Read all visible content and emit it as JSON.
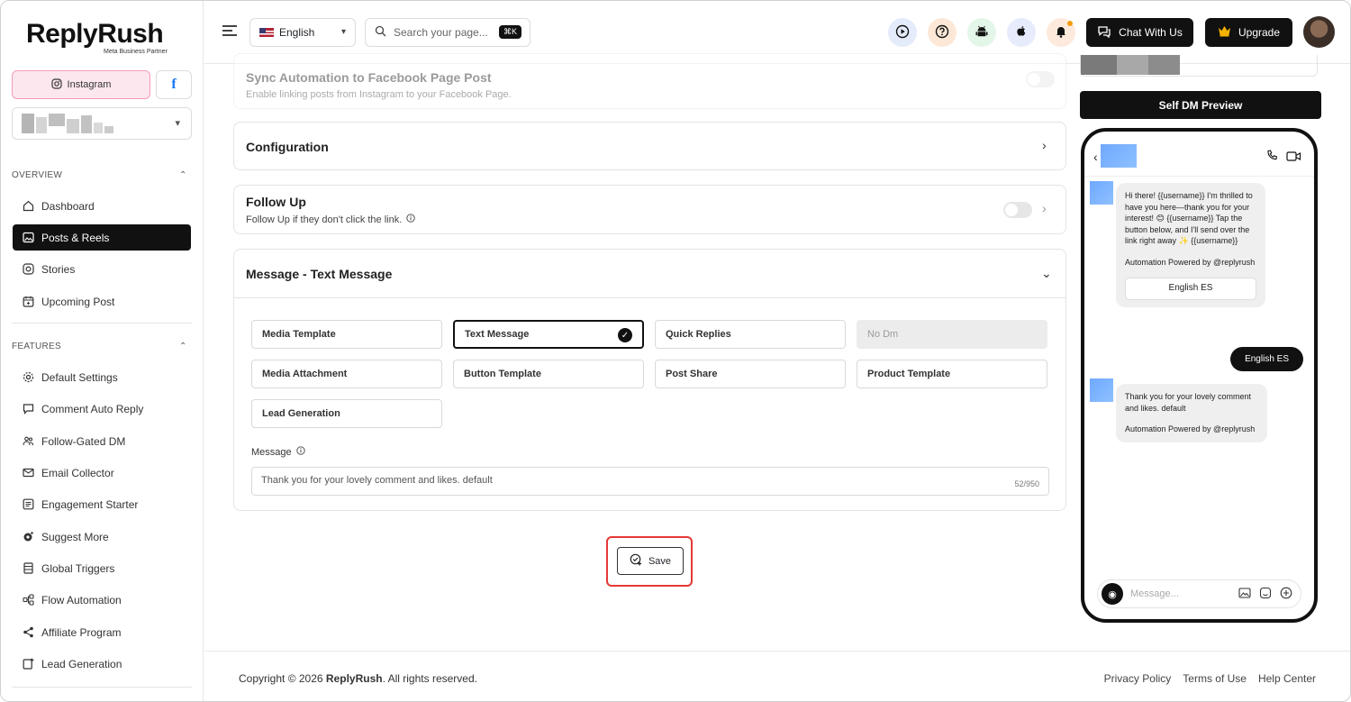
{
  "brand": {
    "name": "ReplyRush",
    "badge": "Meta Business Partner"
  },
  "account": {
    "instagram_label": "Instagram",
    "facebook_glyph": "f"
  },
  "sidebar": {
    "overview_title": "OVERVIEW",
    "features_title": "FEATURES",
    "overview_items": [
      {
        "label": "Dashboard",
        "icon": "home-icon"
      },
      {
        "label": "Posts & Reels",
        "icon": "image-icon",
        "active": true
      },
      {
        "label": "Stories",
        "icon": "instagram-icon"
      },
      {
        "label": "Upcoming Post",
        "icon": "calendar-icon"
      }
    ],
    "feature_items": [
      {
        "label": "Default Settings",
        "icon": "gear-icon"
      },
      {
        "label": "Comment Auto Reply",
        "icon": "comment-icon"
      },
      {
        "label": "Follow-Gated DM",
        "icon": "users-icon"
      },
      {
        "label": "Email Collector",
        "icon": "mail-icon"
      },
      {
        "label": "Engagement Starter",
        "icon": "list-icon"
      },
      {
        "label": "Suggest More",
        "icon": "sparkle-gear-icon"
      },
      {
        "label": "Global Triggers",
        "icon": "stack-icon"
      },
      {
        "label": "Flow Automation",
        "icon": "flow-icon"
      },
      {
        "label": "Affiliate Program",
        "icon": "share-icon"
      },
      {
        "label": "Lead Generation",
        "icon": "lead-icon"
      }
    ]
  },
  "topbar": {
    "language": "English",
    "search_placeholder": "Search your page...",
    "search_shortcut": "⌘K",
    "chat_label": "Chat With Us",
    "upgrade_label": "Upgrade"
  },
  "cards": {
    "sync": {
      "title": "Sync Automation to Facebook Page Post",
      "subtitle": "Enable linking posts from Instagram to your Facebook Page."
    },
    "configuration": {
      "title": "Configuration"
    },
    "follow_up": {
      "title": "Follow Up",
      "subtitle": "Follow Up if they don't click the link."
    },
    "message": {
      "title": "Message - Text Message",
      "options": [
        "Media Template",
        "Text Message",
        "Quick Replies",
        "No Dm",
        "Media Attachment",
        "Button Template",
        "Post Share",
        "Product Template",
        "Lead Generation"
      ],
      "selected": "Text Message",
      "disabled": "No Dm",
      "message_label": "Message",
      "message_value": "Thank you for your lovely comment and likes. default",
      "counter": "52/950"
    }
  },
  "save_label": "Save",
  "preview": {
    "button_label": "Self DM Preview",
    "bubble1": {
      "text": "Hi there! {{username}} I'm thrilled to have you here—thank you for your interest! 😊 {{username}} Tap the button below, and I'll send over the link right away ✨ {{username}}",
      "powered": "Automation Powered by @replyrush",
      "button": "English ES"
    },
    "outgoing": "English ES",
    "bubble2": {
      "text": "Thank you for your lovely comment and likes. default",
      "powered": "Automation Powered by @replyrush"
    },
    "composer_placeholder": "Message..."
  },
  "footer": {
    "copyright_prefix": "Copyright © 2026",
    "copyright_brand": "ReplyRush",
    "copyright_suffix": ". All rights reserved.",
    "links": [
      "Privacy Policy",
      "Terms of Use",
      "Help Center"
    ]
  },
  "colors": {
    "accent": "#111111",
    "highlight": "#e53935",
    "instagram_pink": "#fde7ee"
  }
}
